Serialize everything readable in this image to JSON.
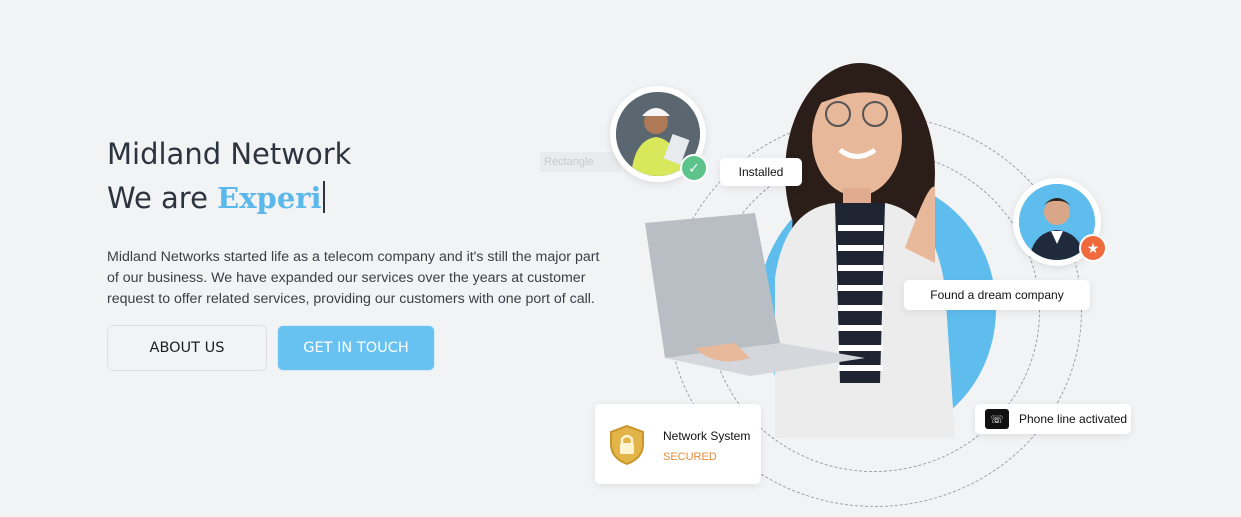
{
  "hero": {
    "title": "Midland Network",
    "subtitle_prefix": "We are ",
    "typed_word": "Experi",
    "description": "Midland Networks started life as a telecom company and it's still the major part of our business. We have expanded our services over the years at customer request to offer related services, providing our customers with one port of call."
  },
  "buttons": {
    "about_label": "ABOUT US",
    "touch_label": "GET IN TOUCH"
  },
  "cards": {
    "installed": "Installed",
    "dream_company": "Found a dream company",
    "phone_activated": "Phone line activated",
    "network_title": "Network System",
    "network_status": "SECURED"
  },
  "ghost_label": "Rectangle",
  "colors": {
    "accent": "#67c1f1",
    "typed": "#5bb8ea",
    "check_badge": "#5cc48a",
    "star_badge": "#ef6b3e",
    "secured": "#e58a3a"
  },
  "icons": {
    "check": "check-icon",
    "star": "star-icon",
    "phone": "phone-icon",
    "shield": "shield-lock-icon"
  }
}
